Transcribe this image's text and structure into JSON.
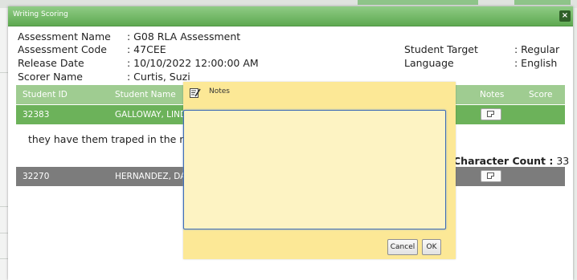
{
  "dialog": {
    "title": "Writing Scoring",
    "close_glyph": "×"
  },
  "info": {
    "assessment_name": {
      "label": "Assessment Name",
      "value": ": G08 RLA Assessment"
    },
    "assessment_code": {
      "label": "Assessment Code",
      "value": ": 47CEE"
    },
    "release_date": {
      "label": "Release Date",
      "value": ": 10/10/2022 12:00:00 AM"
    },
    "scorer_name": {
      "label": "Scorer Name",
      "value": ": Curtis, Suzi"
    },
    "student_target": {
      "label": "Student Target",
      "value": ": Regular"
    },
    "language": {
      "label": "Language",
      "value": ": English"
    }
  },
  "table": {
    "headers": {
      "student_id": "Student ID",
      "student_name": "Student Name",
      "notes": "Notes",
      "score": "Score"
    },
    "rows": [
      {
        "student_id": "32383",
        "student_name": "GALLOWAY, LIND"
      },
      {
        "student_id": "32270",
        "student_name": "HERNANDEZ, DAN"
      }
    ]
  },
  "response": {
    "text": "they have them traped in the ma:",
    "character_count_label": "Character Count :",
    "character_count": "33"
  },
  "notes_dialog": {
    "title": "Notes",
    "text": "",
    "cancel_label": "Cancel",
    "ok_label": "OK",
    "icon": "notepad-pencil-icon"
  },
  "colors": {
    "titlebar": "#6cb25a",
    "header_row": "#9fcc91",
    "selected_row": "#6cb25a",
    "other_row": "#7c7c7c",
    "notes_bg": "#fce896",
    "textarea_border": "#3f6db5"
  }
}
